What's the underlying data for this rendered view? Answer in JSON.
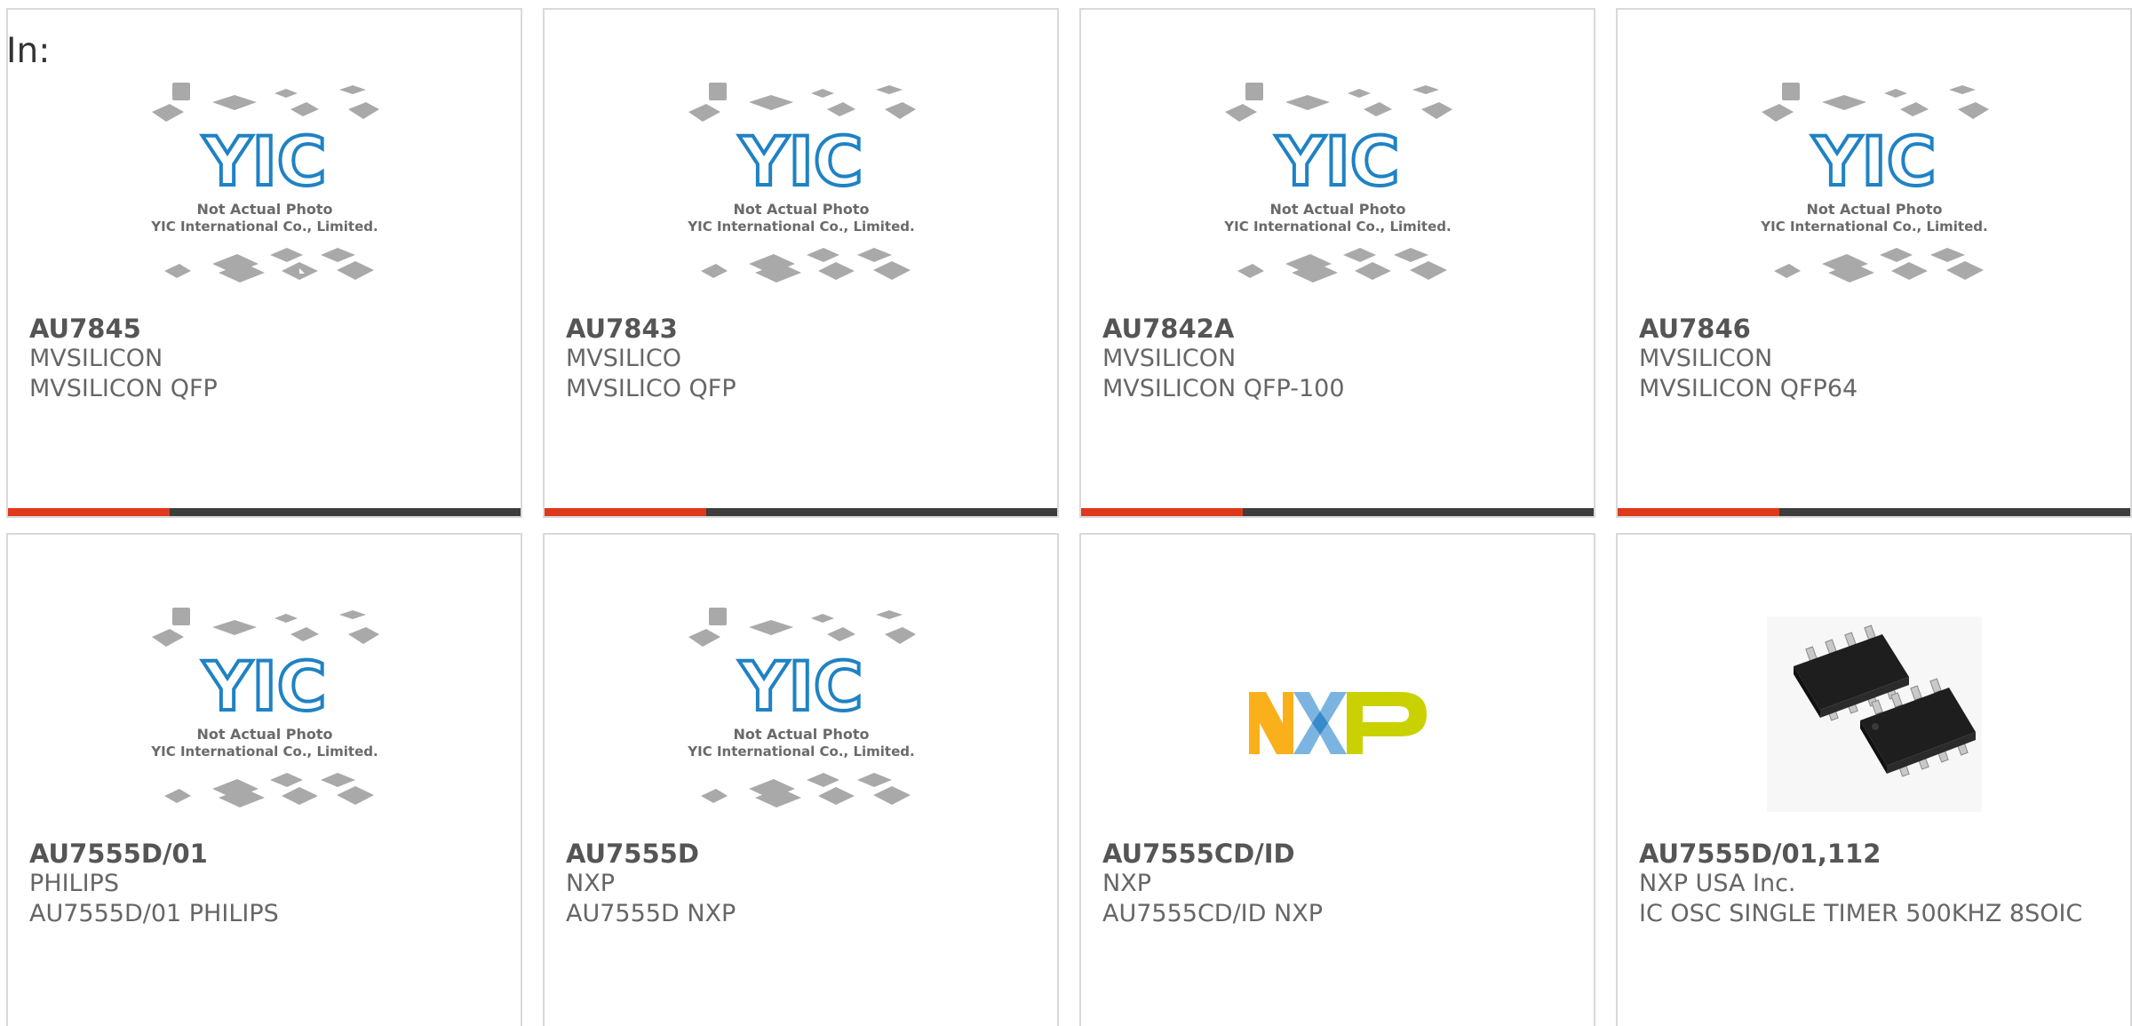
{
  "header": {
    "in_label": "In:"
  },
  "placeholder": {
    "logo_text": "YIC",
    "line1": "Not Actual Photo",
    "line2": "YIC International Co., Limited."
  },
  "nxp_logo_text": "NXP",
  "colors": {
    "accent": "#e0381a",
    "bar": "#3d3d3d",
    "border": "#d9d9d9",
    "text": "#666666",
    "yic_blue": "#1f82c4"
  },
  "products": [
    {
      "part": "AU7845",
      "manufacturer": "MVSILICON",
      "description": "MVSILICON QFP",
      "image": "yic-placeholder"
    },
    {
      "part": "AU7843",
      "manufacturer": "MVSILICO",
      "description": "MVSILICO QFP",
      "image": "yic-placeholder"
    },
    {
      "part": "AU7842A",
      "manufacturer": "MVSILICON",
      "description": "MVSILICON QFP-100",
      "image": "yic-placeholder"
    },
    {
      "part": "AU7846",
      "manufacturer": "MVSILICON",
      "description": "MVSILICON QFP64",
      "image": "yic-placeholder"
    },
    {
      "part": "AU7555D/01",
      "manufacturer": "PHILIPS",
      "description": "AU7555D/01 PHILIPS",
      "image": "yic-placeholder"
    },
    {
      "part": "AU7555D",
      "manufacturer": "NXP",
      "description": "AU7555D NXP",
      "image": "yic-placeholder"
    },
    {
      "part": "AU7555CD/ID",
      "manufacturer": "NXP",
      "description": "AU7555CD/ID NXP",
      "image": "nxp-logo"
    },
    {
      "part": "AU7555D/01,112",
      "manufacturer": "NXP USA Inc.",
      "description": "IC OSC SINGLE TIMER 500KHZ 8SOIC",
      "image": "soic8-photo"
    }
  ]
}
